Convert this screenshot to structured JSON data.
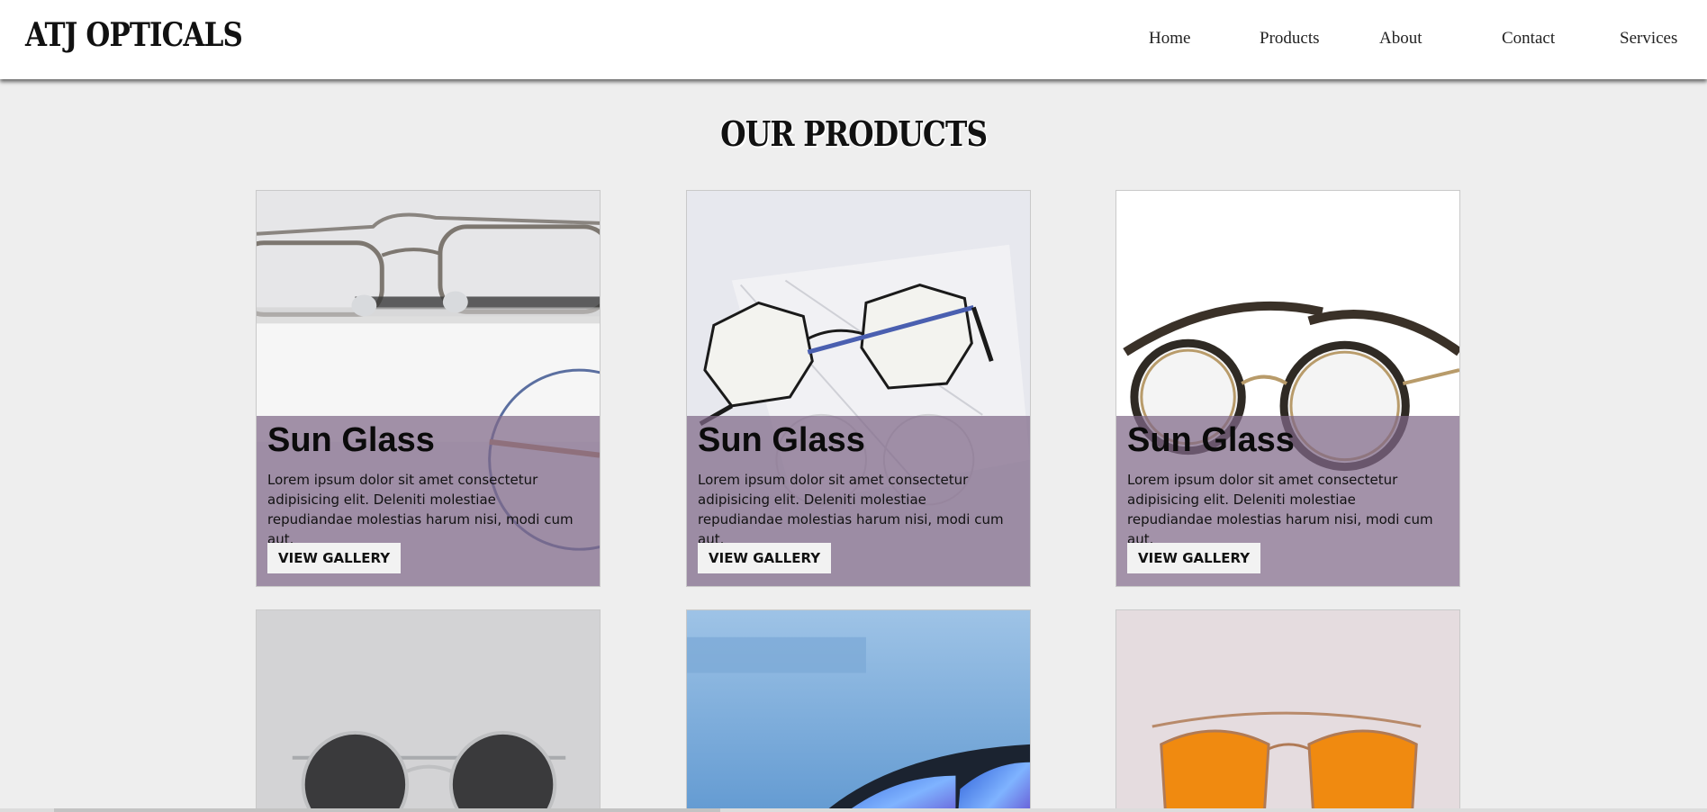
{
  "header": {
    "logo": "ATJ OPTICALS",
    "nav": [
      {
        "label": "Home"
      },
      {
        "label": "Products"
      },
      {
        "label": "About"
      },
      {
        "label": "Contact"
      },
      {
        "label": "Services"
      }
    ]
  },
  "products_section": {
    "title": "OUR PRODUCTS",
    "cards": [
      {
        "title": "Sun Glass",
        "description": "Lorem ipsum dolor sit amet consectetur adipisicing elit. Deleniti molestiae repudiandae molestias harum nisi, modi cum aut.",
        "button_label": "VIEW GALLERY",
        "image": "eyeglasses-photo"
      },
      {
        "title": "Sun Glass",
        "description": "Lorem ipsum dolor sit amet consectetur adipisicing elit. Deleniti molestiae repudiandae molestias harum nisi, modi cum aut.",
        "button_label": "VIEW GALLERY",
        "image": "octagonal-glasses-photo"
      },
      {
        "title": "Sun Glass",
        "description": "Lorem ipsum dolor sit amet consectetur adipisicing elit. Deleniti molestiae repudiandae molestias harum nisi, modi cum aut.",
        "button_label": "VIEW GALLERY",
        "image": "round-tortoise-glasses-photo"
      },
      {
        "image": "black-round-sunglasses-photo"
      },
      {
        "image": "blue-mirrored-sunglasses-photo"
      },
      {
        "image": "orange-aviator-sunglasses-photo"
      }
    ]
  },
  "colors": {
    "page_background": "#eeeeee",
    "header_background": "#ffffff",
    "overlay": "#806888",
    "button_background": "#f2f2f2"
  }
}
